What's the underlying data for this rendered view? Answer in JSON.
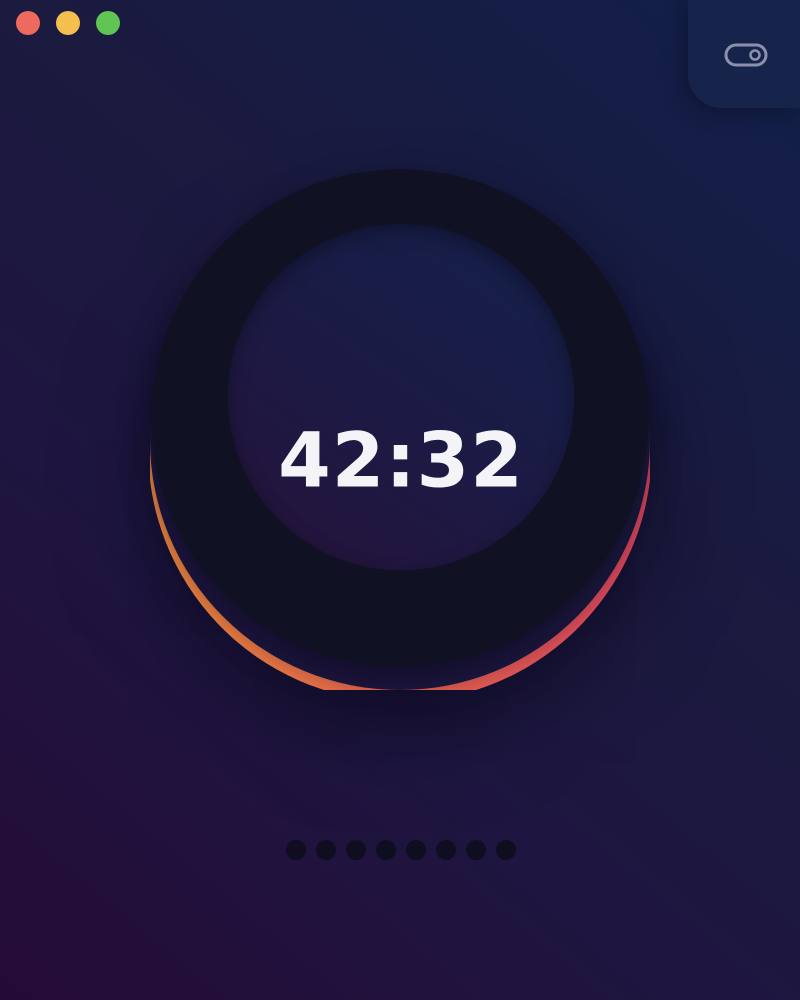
{
  "window": {
    "controls": [
      "close",
      "minimize",
      "zoom"
    ]
  },
  "toolbar": {
    "toggle_icon": "toggle-switch-icon"
  },
  "timer": {
    "display": "42:32",
    "progress_fraction": 0.5,
    "arc_colors": {
      "start": "#f0883d",
      "end": "#e0465f"
    }
  },
  "page_indicator": {
    "count": 8
  },
  "colors": {
    "background_top": "#11204a",
    "background_bottom": "#240b36",
    "ring": "#111124",
    "text": "#f4f4f8"
  }
}
